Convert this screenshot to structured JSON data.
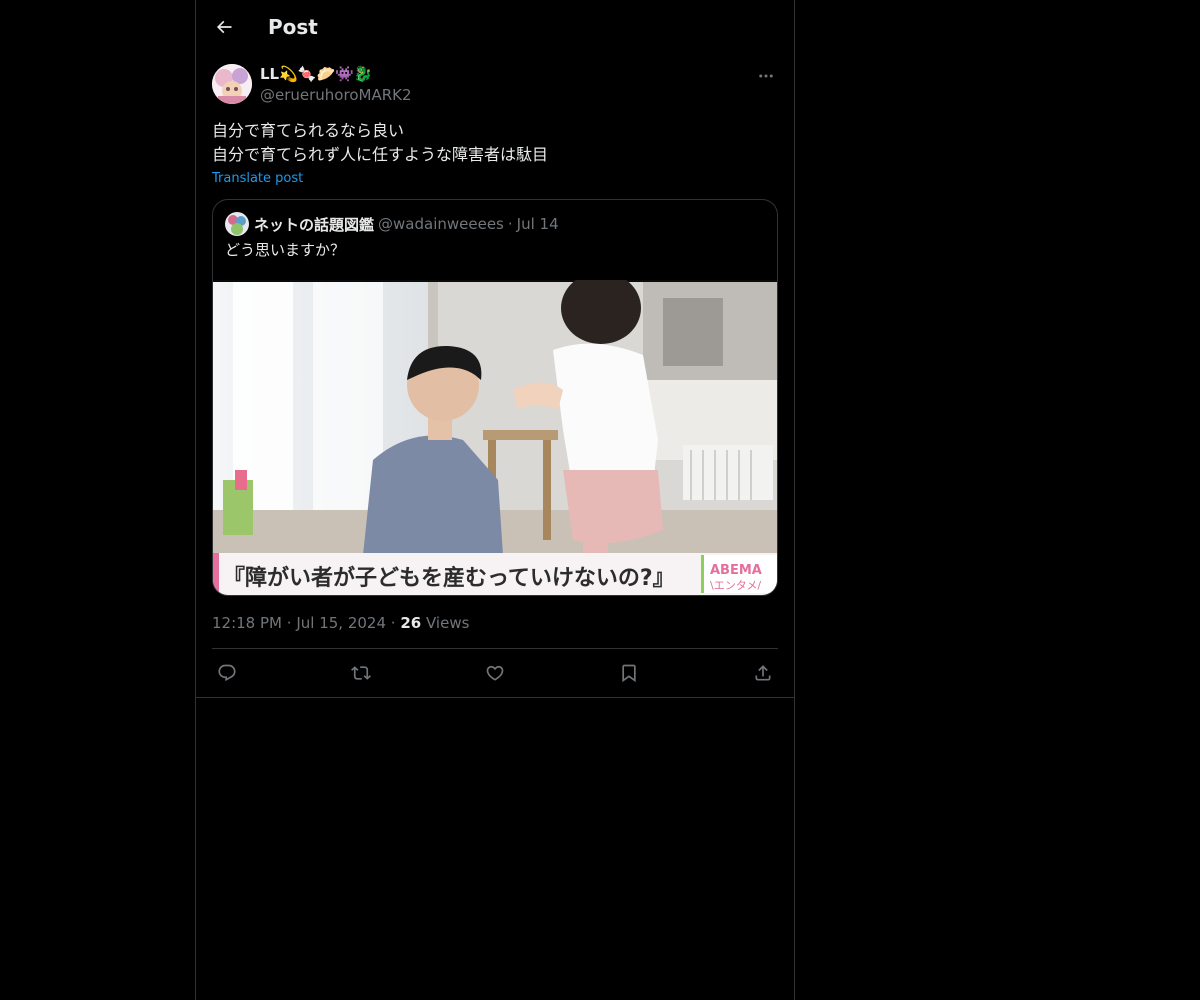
{
  "header": {
    "title": "Post"
  },
  "post": {
    "author_name": "LL💫🍬🥟👾🐉",
    "author_handle": "@erueruhoroMARK2",
    "lines": [
      "自分で育てられるなら良い",
      "自分で育てられず人に任すような障害者は駄目"
    ],
    "translate_label": "Translate post",
    "time": "12:18 PM",
    "date": "Jul 15, 2024",
    "views_count": "26",
    "views_label": "Views",
    "separator": "·"
  },
  "quote": {
    "author_name": "ネットの話題図鑑",
    "author_handle": "@wadainweeees",
    "separator": "·",
    "date": "Jul 14",
    "text": "どう思いますか？",
    "caption": "『障がい者が子どもを産むっていけないの?』",
    "logo_top": "ABEMA",
    "logo_bottom": "\\エンタメ/"
  },
  "actions": {
    "icons": [
      "reply-icon",
      "repost-icon",
      "like-icon",
      "bookmark-icon",
      "share-icon"
    ]
  },
  "colors": {
    "background": "#000000",
    "text": "#e7e9ea",
    "secondary": "#71767b",
    "link": "#1d9bf0",
    "border": "#2f3336"
  }
}
